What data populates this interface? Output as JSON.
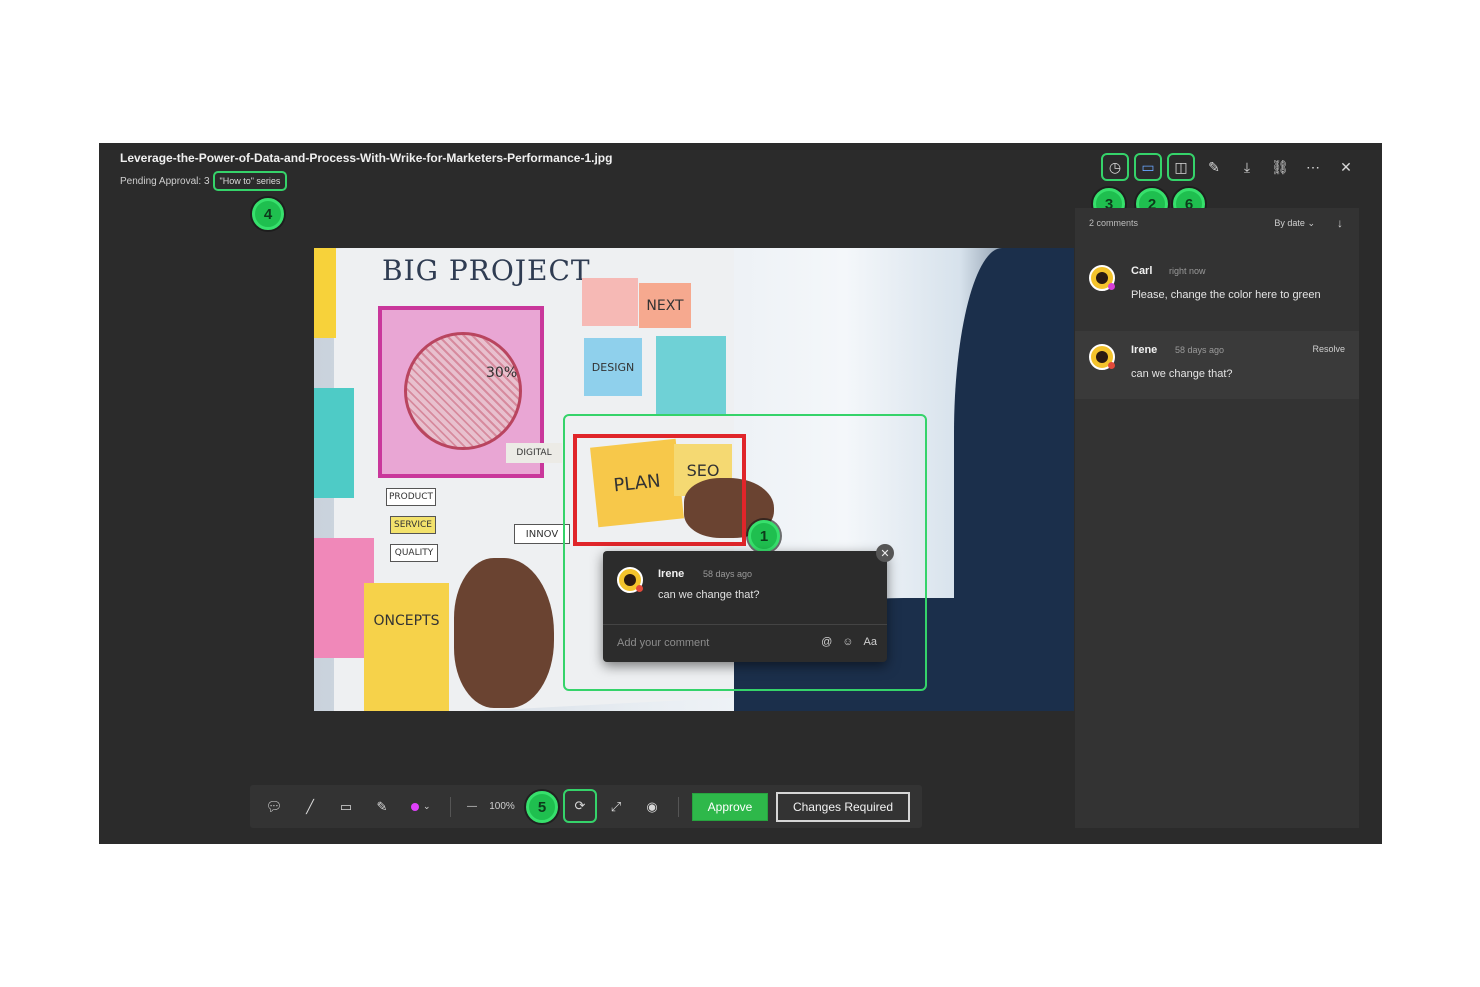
{
  "header": {
    "file_name": "Leverage-the-Power-of-Data-and-Process-With-Wrike-for-Marketers-Performance-1.jpg",
    "status": "Pending Approval: 3",
    "series_tag": "\"How to\" series"
  },
  "top_icons": [
    {
      "name": "clock-icon",
      "glyph": "◷"
    },
    {
      "name": "comment-icon",
      "glyph": "▭"
    },
    {
      "name": "compare-icon",
      "glyph": "◫"
    },
    {
      "name": "pencil-icon",
      "glyph": "✎"
    },
    {
      "name": "download-icon",
      "glyph": "⤓"
    },
    {
      "name": "link-icon",
      "glyph": "⛓"
    },
    {
      "name": "more-icon",
      "glyph": "⋯"
    },
    {
      "name": "close-icon",
      "glyph": "✕"
    }
  ],
  "badges": [
    "1",
    "2",
    "3",
    "4",
    "5",
    "6"
  ],
  "canvas": {
    "big_project": "BIG PROJECT",
    "notes": {
      "plan": "PLAN",
      "seo": "SEO",
      "next": "NEXT",
      "design": "DESIGN",
      "concepts": "ONCEPTS",
      "product": "PRODUCT",
      "service": "SERVICE",
      "quality": "QUALITY",
      "innov": "INNOV",
      "digital": "DIGITAL",
      "percent": "30%"
    }
  },
  "popup": {
    "author": "Irene",
    "time": "58 days ago",
    "text": "can we change that?",
    "add_placeholder": "Add your comment",
    "icons": [
      "@",
      "☺",
      "Aa"
    ]
  },
  "sidebar": {
    "count": "2 comments",
    "sort": "By date",
    "sort_dir_glyph": "↓",
    "comments": [
      {
        "author": "Carl",
        "time": "right now",
        "text": "Please, change the color here to green",
        "resolve": ""
      },
      {
        "author": "Irene",
        "time": "58 days ago",
        "text": "can we change that?",
        "resolve": "Resolve"
      }
    ]
  },
  "toolbar": {
    "zoom_minus": "—",
    "zoom": "100%",
    "approve": "Approve",
    "changes_required": "Changes Required",
    "color_dot": "#e040fb"
  },
  "colors": {
    "accent_green": "#35d36a",
    "approve_green": "#2eb84a",
    "highlight_red": "#e0252a",
    "active_blue": "#6aa7ff"
  }
}
